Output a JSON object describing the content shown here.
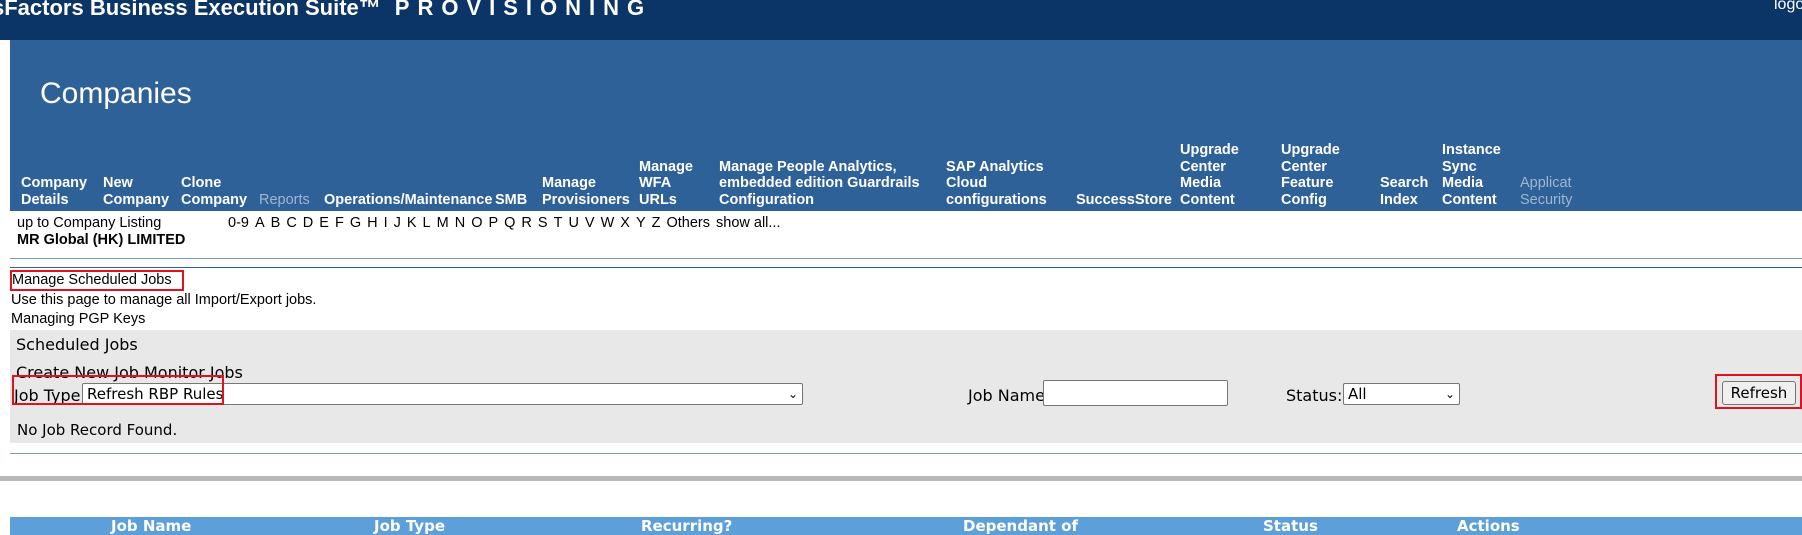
{
  "header": {
    "suite_title": "sFactors Business Execution Suite™",
    "suite_subtitle": "PROVISIONING",
    "logout": "logo"
  },
  "page_title": "Companies",
  "nav": {
    "items": [
      {
        "label": "Company\nDetails"
      },
      {
        "label": "New\nCompany"
      },
      {
        "label": "Clone\nCompany"
      },
      {
        "label": "Reports"
      },
      {
        "label": "Operations/Maintenance"
      },
      {
        "label": "SMB"
      },
      {
        "label": "Manage\nProvisioners"
      },
      {
        "label": "Manage\nWFA\nURLs"
      },
      {
        "label": "Manage People Analytics,\nembedded edition Guardrails\nConfiguration"
      },
      {
        "label": "SAP Analytics\nCloud\nconfigurations"
      },
      {
        "label": "SuccessStore"
      },
      {
        "label": "Upgrade\nCenter\nMedia\nContent"
      },
      {
        "label": "Upgrade\nCenter\nFeature\nConfig"
      },
      {
        "label": "Search\nIndex"
      },
      {
        "label": "Instance\nSync\nMedia\nContent"
      },
      {
        "label": "Applicat\nSecurity"
      }
    ]
  },
  "company_bar": {
    "up_link": "up to Company Listing",
    "company_name": "MR Global (HK) LIMITED",
    "alphabet": [
      "0-9",
      "A",
      "B",
      "C",
      "D",
      "E",
      "F",
      "G",
      "H",
      "I",
      "J",
      "K",
      "L",
      "M",
      "N",
      "O",
      "P",
      "Q",
      "R",
      "S",
      "T",
      "U",
      "V",
      "W",
      "X",
      "Y",
      "Z",
      "Others",
      "show all..."
    ]
  },
  "section": {
    "manage_link": "Manage Scheduled Jobs",
    "description": "Use this page to manage all Import/Export jobs.",
    "pgp_link": "Managing PGP Keys"
  },
  "jobs": {
    "scheduled_tab": "Scheduled Jobs",
    "create_tab": "Create New Job Monitor Jobs",
    "job_type_label": "Job Type:",
    "job_type_value": "Refresh RBP Rules",
    "job_name_label": "Job Name:",
    "job_name_value": "",
    "status_label": "Status:",
    "status_value": "All",
    "refresh_button": "Refresh",
    "columns": [
      "Job Name",
      "Job Type",
      "Recurring?",
      "Dependant of",
      "Status",
      "Actions"
    ],
    "empty_message": "No Job Record Found."
  },
  "colors": {
    "topbar": "#0b3567",
    "panel": "#2f6199",
    "table_header": "#5d9fd8",
    "highlight_box": "#e0121f"
  }
}
